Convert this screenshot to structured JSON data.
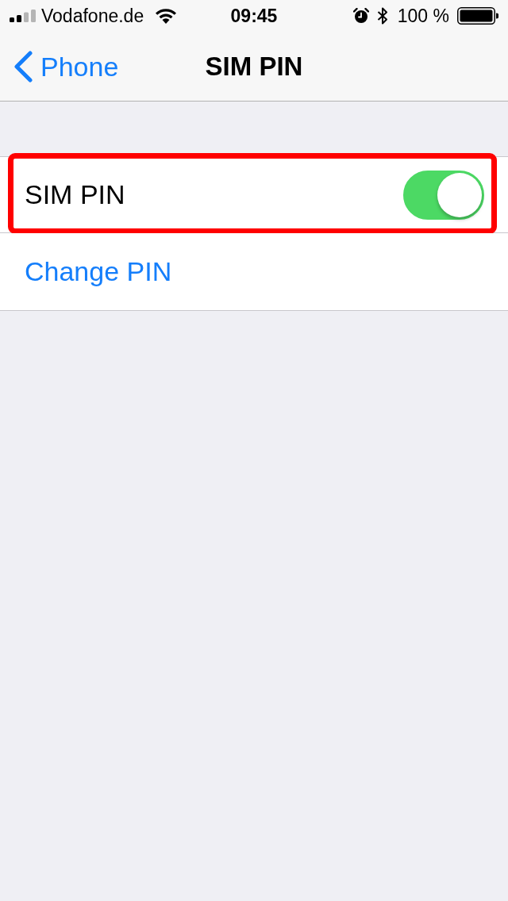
{
  "status_bar": {
    "carrier": "Vodafone.de",
    "time": "09:45",
    "battery": "100 %"
  },
  "nav_bar": {
    "back": "Phone",
    "title": "SIM PIN"
  },
  "rows": [
    {
      "kind": "toggle",
      "label": "SIM PIN",
      "on": true,
      "highlighted": true
    },
    {
      "kind": "link",
      "label": "Change PIN",
      "highlighted": false
    }
  ]
}
